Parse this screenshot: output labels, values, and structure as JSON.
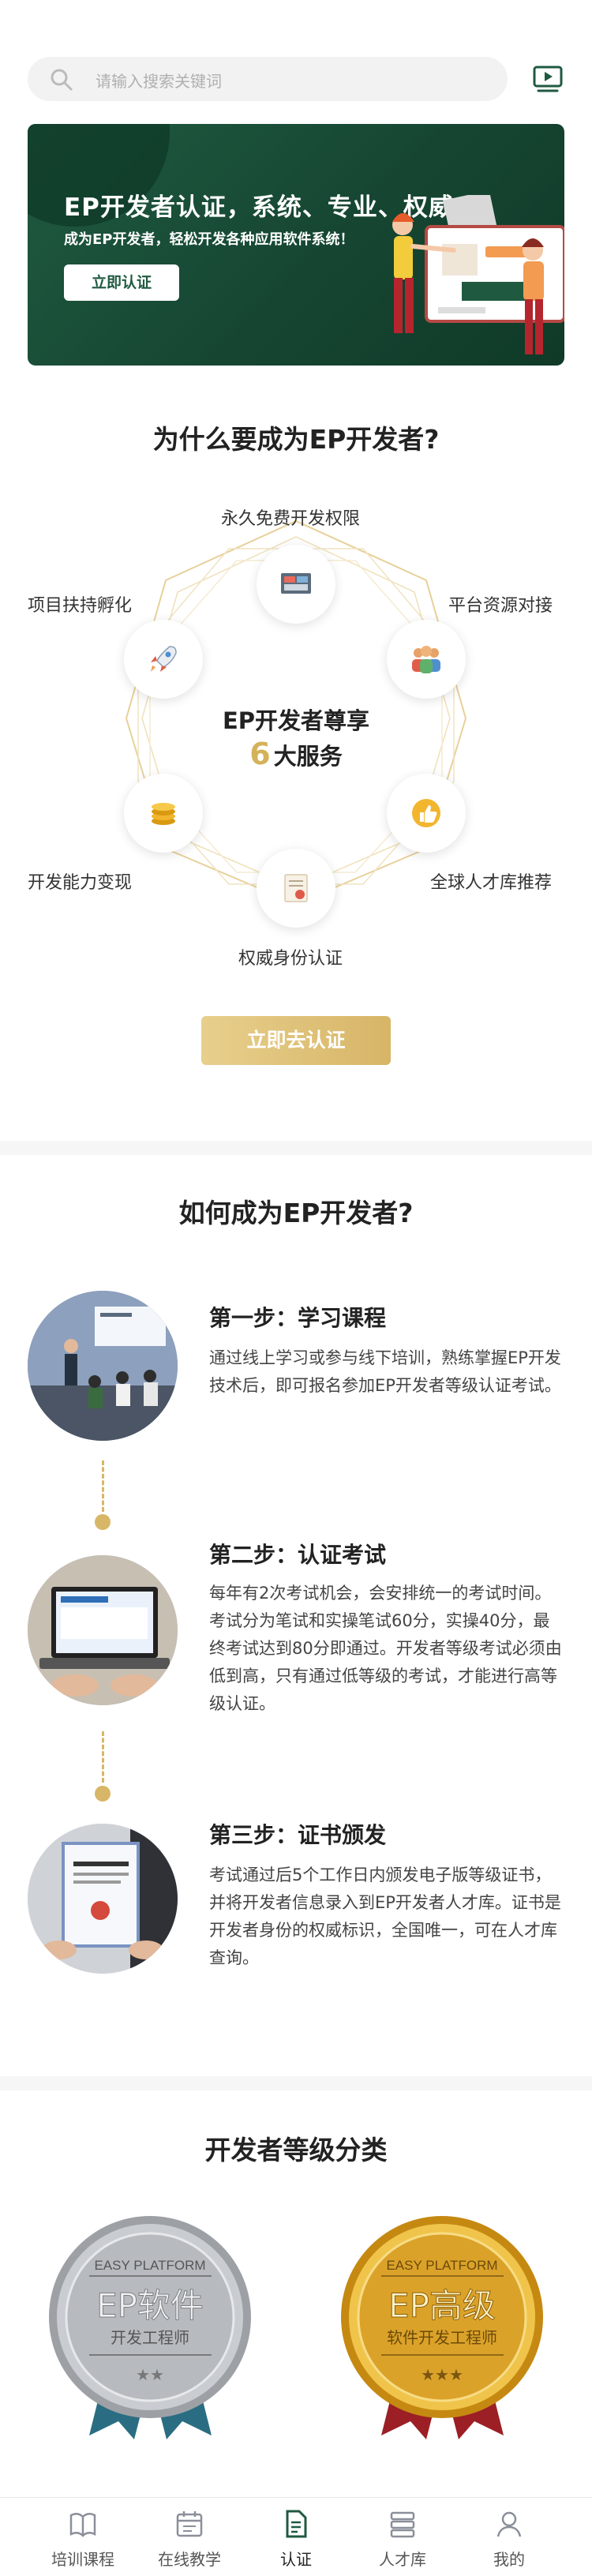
{
  "search": {
    "placeholder": "请输入搜索关键词"
  },
  "banner": {
    "title": "EP开发者认证，系统、专业、权威",
    "subtitle": "成为EP开发者，轻松开发各种应用软件系统！",
    "cta": "立即认证"
  },
  "why": {
    "title": "为什么要成为EP开发者?",
    "center_line1": "EP开发者尊享",
    "center_number": "6",
    "center_line2": "大服务",
    "services": [
      {
        "label": "永久免费开发权限",
        "icon": "device-icon"
      },
      {
        "label": "平台资源对接",
        "icon": "people-icon"
      },
      {
        "label": "全球人才库推荐",
        "icon": "thumbs-up-icon"
      },
      {
        "label": "权威身份认证",
        "icon": "certificate-icon"
      },
      {
        "label": "开发能力变现",
        "icon": "coins-icon"
      },
      {
        "label": "项目扶持孵化",
        "icon": "rocket-icon"
      }
    ],
    "cta": "立即去认证"
  },
  "how": {
    "title": "如何成为EP开发者?",
    "steps": [
      {
        "title": "第一步：学习课程",
        "desc": "通过线上学习或参与线下培训，熟练掌握EP开发技术后，即可报名参加EP开发者等级认证考试。"
      },
      {
        "title": "第二步：认证考试",
        "desc": "每年有2次考试机会，会安排统一的考试时间。考试分为笔试和实操笔试60分，实操40分，最终考试达到80分即通过。开发者等级考试必须由低到高，只有通过低等级的考试，才能进行高等级认证。"
      },
      {
        "title": "第三步：证书颁发",
        "desc": "考试通过后5个工作日内颁发电子版等级证书，并将开发者信息录入到EP开发者人才库。证书是开发者身份的权威标识，全国唯一，可在人才库查询。"
      }
    ]
  },
  "levels": {
    "title": "开发者等级分类",
    "badges": [
      {
        "top": "EASY PLATFORM",
        "main": "EP软件",
        "sub": "开发工程师",
        "stars": "★★",
        "tone": "silver"
      },
      {
        "top": "EASY PLATFORM",
        "main": "EP高级",
        "sub": "软件开发工程师",
        "stars": "★★★",
        "tone": "gold"
      }
    ]
  },
  "nav": {
    "items": [
      {
        "label": "培训课程",
        "icon": "book-icon"
      },
      {
        "label": "在线教学",
        "icon": "calendar-icon"
      },
      {
        "label": "认证",
        "icon": "document-icon",
        "active": true
      },
      {
        "label": "人才库",
        "icon": "stack-icon"
      },
      {
        "label": "我的",
        "icon": "user-icon"
      }
    ]
  }
}
